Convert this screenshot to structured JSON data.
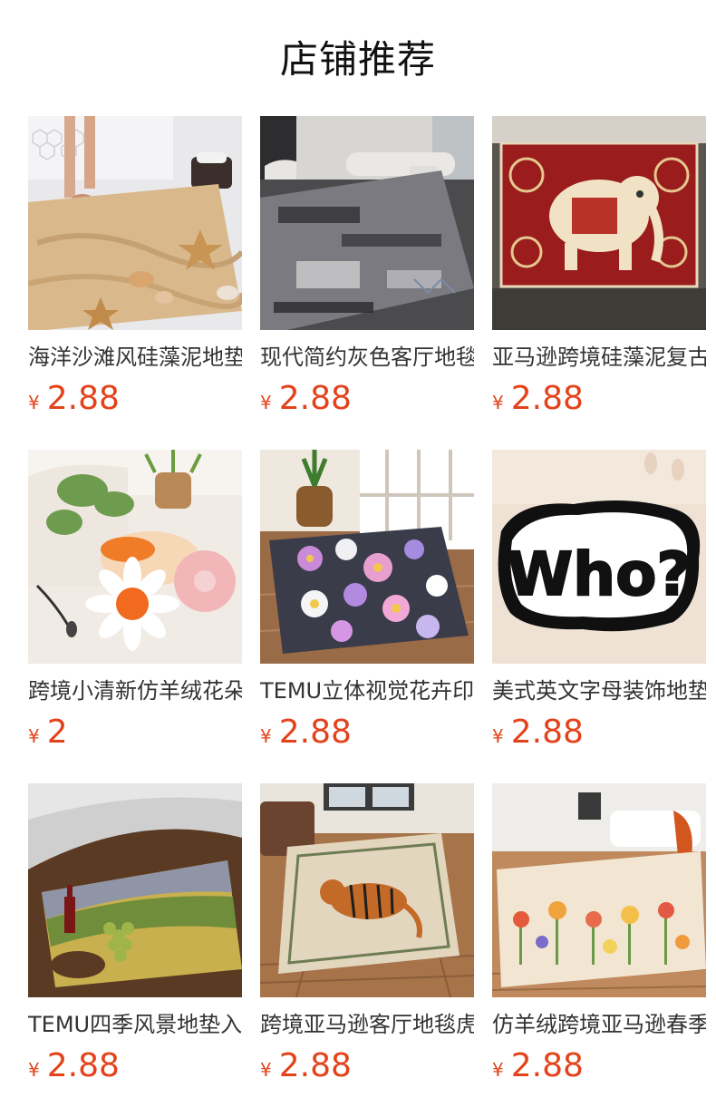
{
  "section": {
    "title": "店铺推荐"
  },
  "currency": "¥",
  "products": [
    {
      "name": "海洋沙滩风硅藻泥地垫",
      "price": "2.88",
      "image": "beach-sand-mat-image"
    },
    {
      "name": "现代简约灰色客厅地毯",
      "price": "2.88",
      "image": "gray-abstract-rug-image"
    },
    {
      "name": "亚马逊跨境硅藻泥复古",
      "price": "2.88",
      "image": "elephant-mat-image"
    },
    {
      "name": "跨境小清新仿羊绒花朵",
      "price": "2",
      "image": "flower-bath-mats-image"
    },
    {
      "name": "TEMU立体视觉花卉印花",
      "price": "2.88",
      "image": "daisy-floral-mat-image"
    },
    {
      "name": "美式英文字母装饰地垫",
      "price": "2.88",
      "image": "who-letter-mat-image"
    },
    {
      "name": "TEMU四季风景地垫入户",
      "price": "2.88",
      "image": "vineyard-landscape-mat-image"
    },
    {
      "name": "跨境亚马逊客厅地毯虎",
      "price": "2.88",
      "image": "tiger-rug-image"
    },
    {
      "name": "仿羊绒跨境亚马逊春季",
      "price": "2.88",
      "image": "spring-floral-rug-image"
    }
  ]
}
